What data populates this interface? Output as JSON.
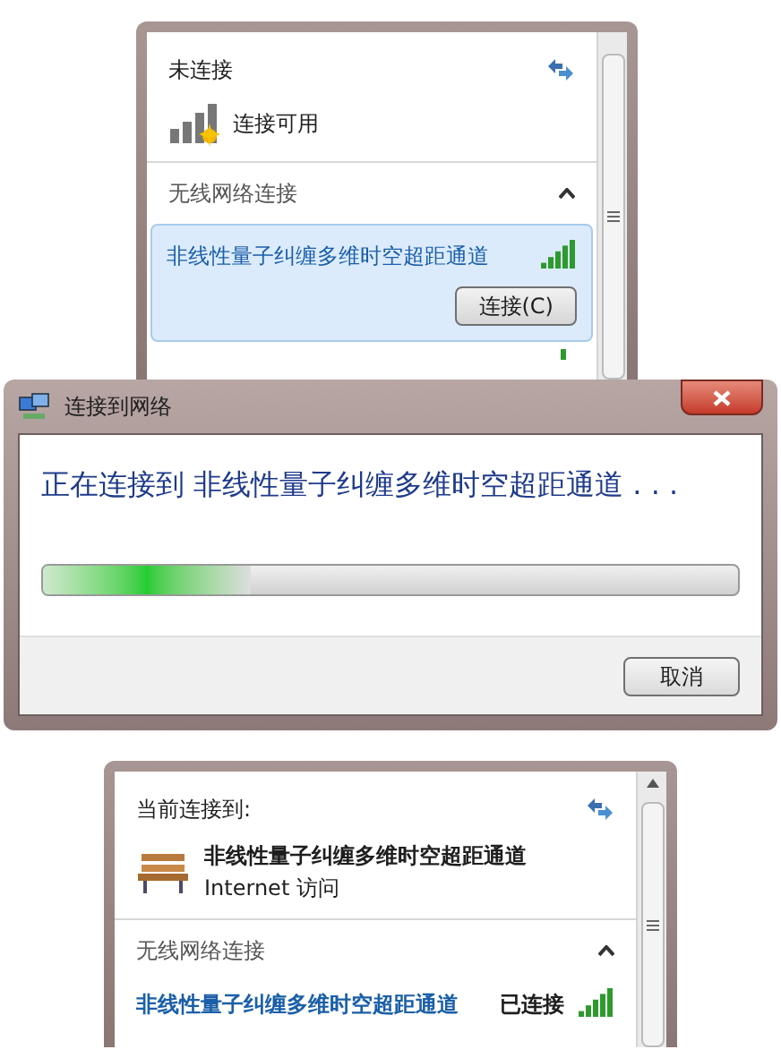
{
  "panel_top": {
    "status": "未连接",
    "connection": "连接可用",
    "section": {
      "title": "无线网络连接",
      "expanded": true
    },
    "network": {
      "name": "非线性量子纠缠多维时空超距通道",
      "selected": true,
      "button": "连接(C)"
    }
  },
  "dialog": {
    "title": "连接到网络",
    "message": "正在连接到 非线性量子纠缠多维时空超距通道 . . .",
    "progress": {
      "level": 0.3
    },
    "button": "取消"
  },
  "panel_bottom": {
    "heading": "当前连接到:",
    "current": {
      "name": "非线性量子纠缠多维时空超距通道",
      "access": "Internet 访问"
    },
    "section": {
      "title": "无线网络连接",
      "expanded": true
    },
    "network": {
      "name": "非线性量子纠缠多维时空超距通道",
      "status": "已连接"
    }
  }
}
